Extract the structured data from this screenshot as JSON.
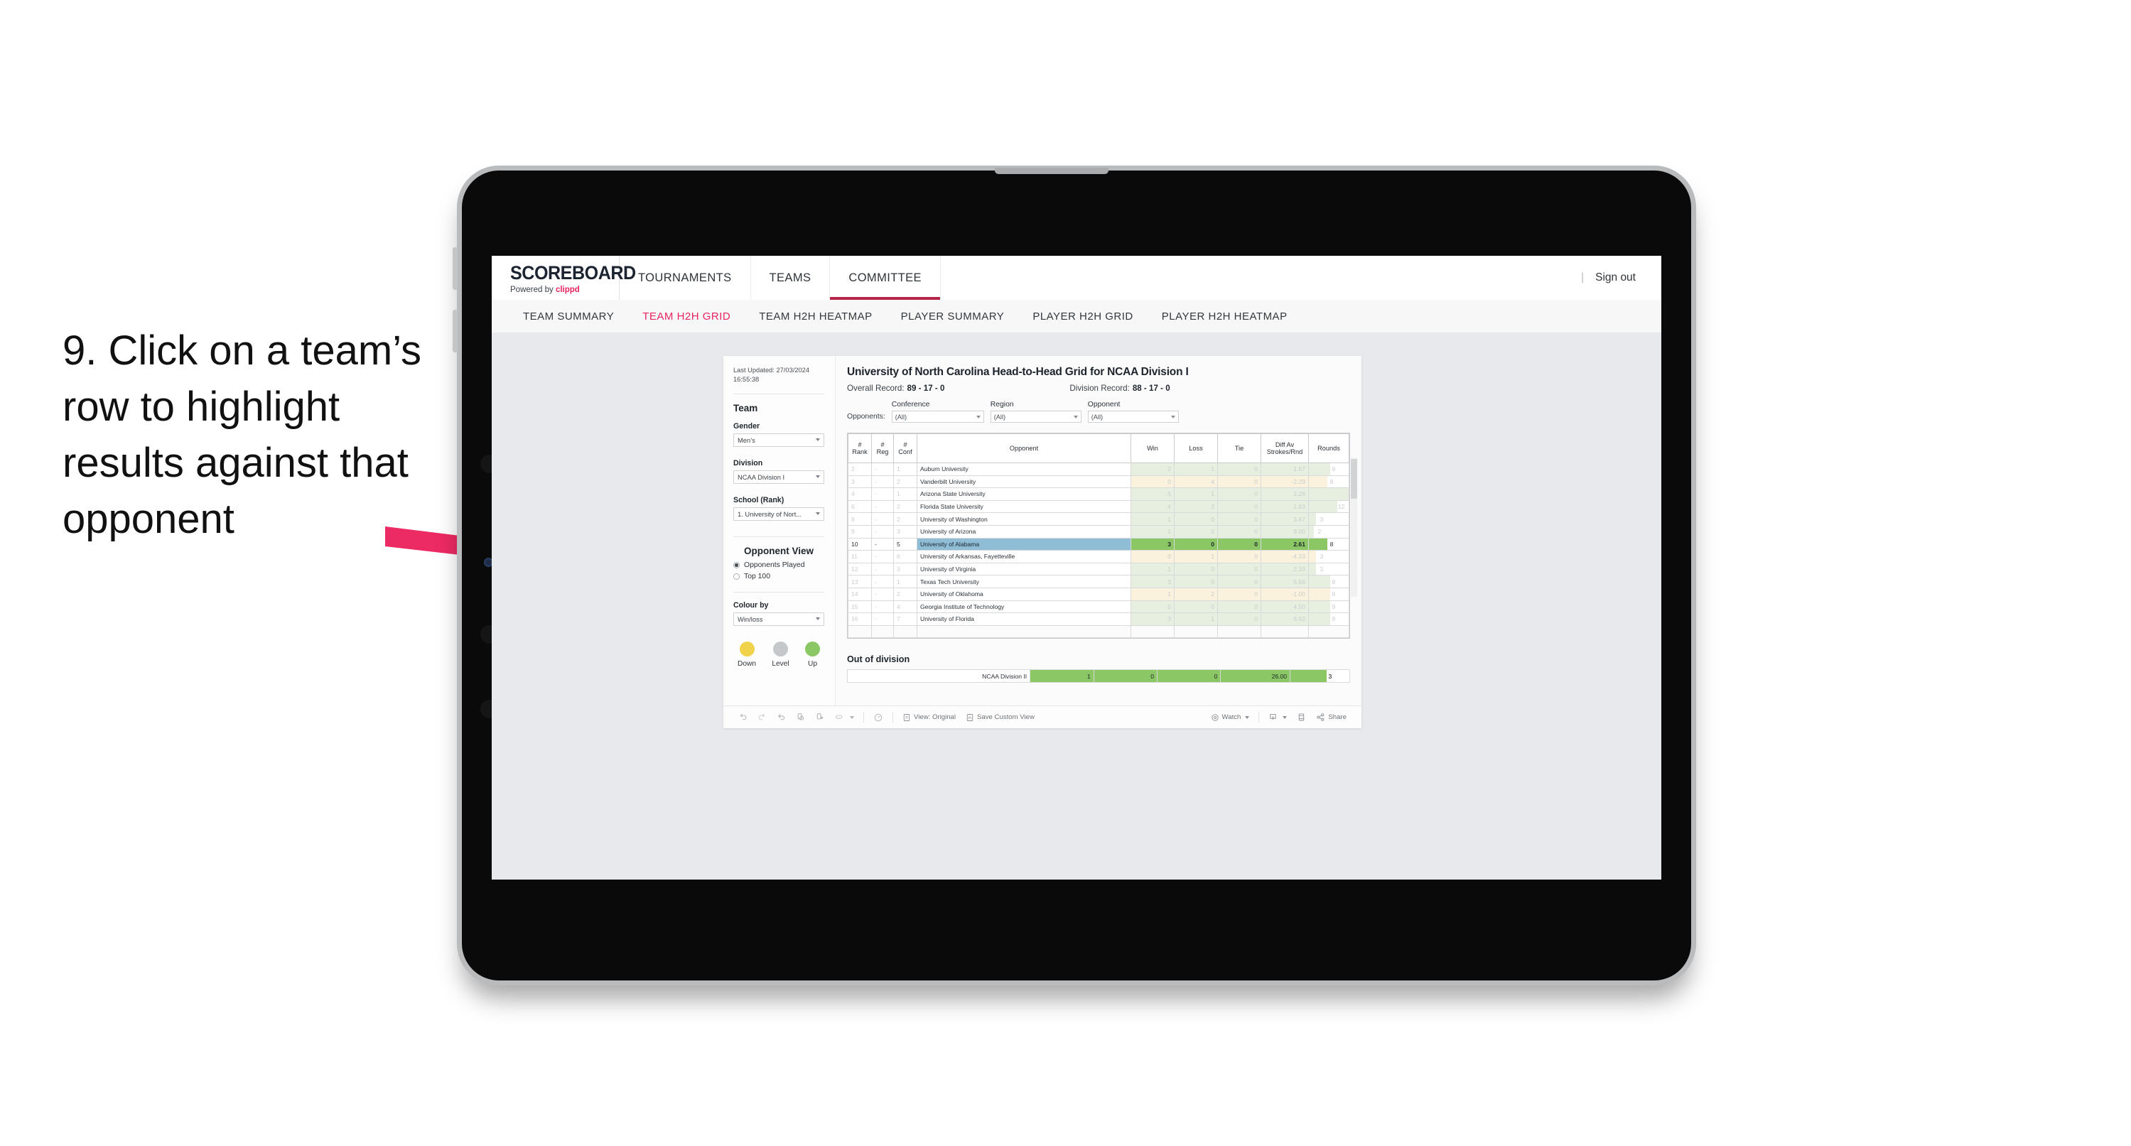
{
  "instruction": {
    "text": "9. Click on a team’s row to highlight results against that opponent",
    "arrow_color": "#ec2a63"
  },
  "app": {
    "brand": {
      "title": "SCOREBOARD",
      "powered_prefix": "Powered by ",
      "powered_brand": "clippd"
    },
    "nav_tabs": [
      {
        "label": "TOURNAMENTS",
        "active": false
      },
      {
        "label": "TEAMS",
        "active": false
      },
      {
        "label": "COMMITTEE",
        "active": true
      }
    ],
    "sign_out": "Sign out",
    "sub_tabs": [
      {
        "label": "TEAM SUMMARY",
        "active": false
      },
      {
        "label": "TEAM H2H GRID",
        "active": true
      },
      {
        "label": "TEAM H2H HEATMAP",
        "active": false
      },
      {
        "label": "PLAYER SUMMARY",
        "active": false
      },
      {
        "label": "PLAYER H2H GRID",
        "active": false
      },
      {
        "label": "PLAYER H2H HEATMAP",
        "active": false
      }
    ],
    "accent_color": "#e8255f",
    "active_underline_color": "#b5254a"
  },
  "panel": {
    "last_updated": "Last Updated: 27/03/2024 16:55:38",
    "team_title": "Team",
    "gender": {
      "label": "Gender",
      "value": "Men’s"
    },
    "division": {
      "label": "Division",
      "value": "NCAA Division I"
    },
    "school": {
      "label": "School (Rank)",
      "value": "1. University of Nort..."
    },
    "opponent_view": {
      "title": "Opponent View",
      "options": [
        {
          "label": "Opponents Played",
          "selected": true
        },
        {
          "label": "Top 100",
          "selected": false
        }
      ]
    },
    "colour_by": {
      "label": "Colour by",
      "value": "Win/loss"
    },
    "legend": [
      {
        "label": "Down",
        "color": "#f0d24b"
      },
      {
        "label": "Level",
        "color": "#c5c8cb"
      },
      {
        "label": "Up",
        "color": "#8cc765"
      }
    ]
  },
  "viz": {
    "title": "University of North Carolina Head-to-Head Grid for NCAA Division I",
    "overall_record": {
      "label": "Overall Record:",
      "value": "89 - 17 - 0"
    },
    "division_record": {
      "label": "Division Record:",
      "value": "88 - 17 - 0"
    },
    "filters": {
      "prefix": "Opponents:",
      "items": [
        {
          "label": "Conference",
          "value": "(All)"
        },
        {
          "label": "Region",
          "value": "(All)"
        },
        {
          "label": "Opponent",
          "value": "(All)"
        }
      ]
    },
    "out_of_division_title": "Out of division"
  },
  "chart_data": {
    "type": "table",
    "title": "University of North Carolina Head-to-Head Grid for NCAA Division I",
    "columns": [
      "# Rank",
      "# Reg",
      "# Conf",
      "Opponent",
      "Win",
      "Loss",
      "Tie",
      "Diff Av Strokes/Rnd",
      "Rounds"
    ],
    "rounds_max": 17,
    "rows": [
      {
        "rank": "2",
        "reg": "-",
        "conf": "1",
        "opponent": "Auburn University",
        "win": "2",
        "loss": "1",
        "tie": "0",
        "diff": "1.67",
        "rounds": "9",
        "state": "win",
        "selected": false
      },
      {
        "rank": "3",
        "reg": "-",
        "conf": "2",
        "opponent": "Vanderbilt University",
        "win": "0",
        "loss": "4",
        "tie": "0",
        "diff": "-2.29",
        "rounds": "8",
        "state": "loss",
        "selected": false
      },
      {
        "rank": "4",
        "reg": "-",
        "conf": "1",
        "opponent": "Arizona State University",
        "win": "5",
        "loss": "1",
        "tie": "0",
        "diff": "2.28",
        "rounds": "17",
        "state": "win",
        "selected": false
      },
      {
        "rank": "6",
        "reg": "-",
        "conf": "2",
        "opponent": "Florida State University",
        "win": "4",
        "loss": "2",
        "tie": "0",
        "diff": "1.83",
        "rounds": "12",
        "state": "win",
        "selected": false
      },
      {
        "rank": "8",
        "reg": "-",
        "conf": "2",
        "opponent": "University of Washington",
        "win": "1",
        "loss": "0",
        "tie": "0",
        "diff": "3.67",
        "rounds": "3",
        "state": "win",
        "selected": false
      },
      {
        "rank": "9",
        "reg": "-",
        "conf": "3",
        "opponent": "University of Arizona",
        "win": "1",
        "loss": "0",
        "tie": "0",
        "diff": "9.00",
        "rounds": "2",
        "state": "win",
        "selected": false
      },
      {
        "rank": "10",
        "reg": "-",
        "conf": "5",
        "opponent": "University of Alabama",
        "win": "3",
        "loss": "0",
        "tie": "0",
        "diff": "2.61",
        "rounds": "8",
        "state": "selected",
        "selected": true
      },
      {
        "rank": "11",
        "reg": "-",
        "conf": "6",
        "opponent": "University of Arkansas, Fayetteville",
        "win": "0",
        "loss": "1",
        "tie": "0",
        "diff": "-4.33",
        "rounds": "3",
        "state": "loss",
        "selected": false
      },
      {
        "rank": "12",
        "reg": "-",
        "conf": "3",
        "opponent": "University of Virginia",
        "win": "1",
        "loss": "0",
        "tie": "0",
        "diff": "2.33",
        "rounds": "3",
        "state": "win",
        "selected": false
      },
      {
        "rank": "13",
        "reg": "-",
        "conf": "1",
        "opponent": "Texas Tech University",
        "win": "3",
        "loss": "0",
        "tie": "0",
        "diff": "5.56",
        "rounds": "9",
        "state": "win",
        "selected": false
      },
      {
        "rank": "14",
        "reg": "-",
        "conf": "2",
        "opponent": "University of Oklahoma",
        "win": "1",
        "loss": "2",
        "tie": "0",
        "diff": "-1.00",
        "rounds": "9",
        "state": "loss",
        "selected": false
      },
      {
        "rank": "15",
        "reg": "-",
        "conf": "4",
        "opponent": "Georgia Institute of Technology",
        "win": "5",
        "loss": "0",
        "tie": "0",
        "diff": "4.50",
        "rounds": "9",
        "state": "win",
        "selected": false
      },
      {
        "rank": "16",
        "reg": "-",
        "conf": "7",
        "opponent": "University of Florida",
        "win": "3",
        "loss": "1",
        "tie": "0",
        "diff": "6.62",
        "rounds": "9",
        "state": "win",
        "selected": false
      }
    ],
    "out_of_division": [
      {
        "label": "NCAA Division II",
        "win": "1",
        "loss": "0",
        "tie": "0",
        "diff": "26.00",
        "rounds": "3"
      }
    ]
  },
  "toolbar": {
    "view_original": "View: Original",
    "save_custom_view": "Save Custom View",
    "watch": "Watch",
    "share": "Share"
  }
}
